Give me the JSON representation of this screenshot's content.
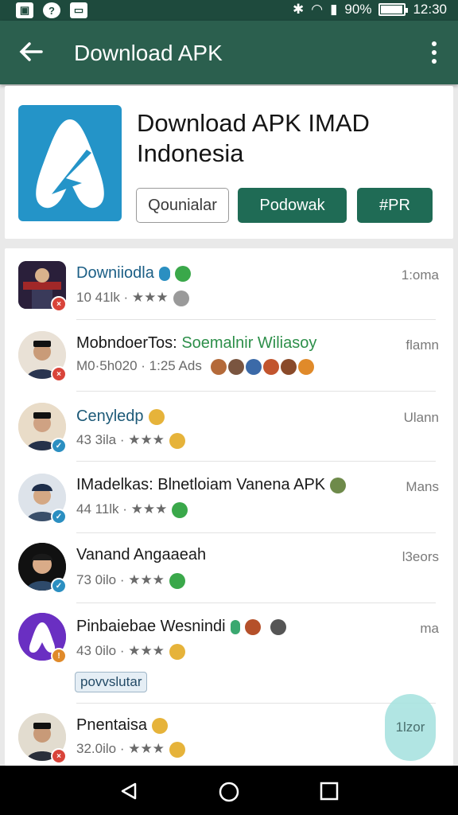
{
  "status_bar": {
    "battery_text": "90%",
    "time": "12:30"
  },
  "toolbar": {
    "title": "Download APK"
  },
  "app": {
    "title_line1": "Download APK IMAD",
    "title_line2": "Indonesia",
    "buttons": {
      "outline": "Qounialar",
      "primary": "Podowak",
      "secondary": "#PR"
    }
  },
  "list": [
    {
      "title": "Downiiodla",
      "sub": "10 41lk · ★★★",
      "right": "1:oma"
    },
    {
      "title": "MobndoerTos:",
      "title_extra": "Soemalnir Wiliasoy",
      "sub": "M0·5h020 · 1:25 Ads",
      "right": "flamn"
    },
    {
      "title": "Cenyledp",
      "sub": "43 3ila · ★★★",
      "right": "Ulann"
    },
    {
      "title": "IMadelkas: Blnetloiam Vanena APK",
      "sub": "44 11lk · ★★★",
      "right": "Mans"
    },
    {
      "title": "Vanand Angaaeah",
      "sub": "73 0ilo · ★★★",
      "right": "l3eors"
    },
    {
      "title": "Pinbaiebae Wesnindi",
      "sub": "43 0ilo · ★★★",
      "right": "ma"
    },
    {
      "title": "Pnentaisa",
      "sub": "32.0ilo · ★★★",
      "right": "1lzor"
    }
  ],
  "chip": {
    "label": "povvslutar"
  },
  "fab": {
    "label": "1lzor"
  },
  "colors": {
    "header": "#2b5f4e",
    "primary_button": "#1f6b55",
    "app_icon": "#2494c8"
  }
}
